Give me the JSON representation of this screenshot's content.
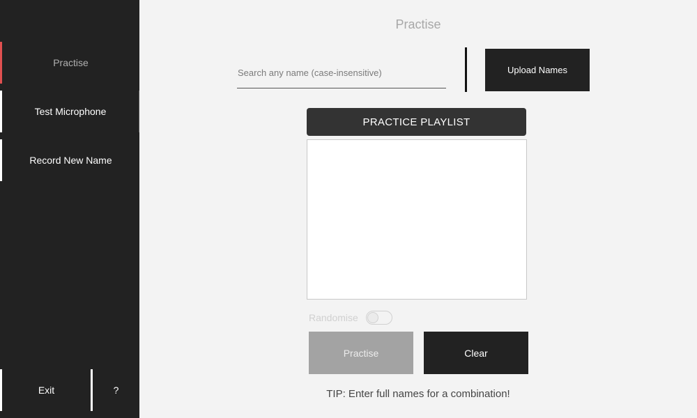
{
  "sidebar": {
    "items": [
      {
        "label": "Practise",
        "active": true
      },
      {
        "label": "Test Microphone",
        "active": false
      },
      {
        "label": "Record New Name",
        "active": false
      }
    ],
    "exit_label": "Exit",
    "help_label": "?"
  },
  "main": {
    "title": "Practise",
    "search": {
      "placeholder": "Search any name (case-insensitive)",
      "value": ""
    },
    "upload_label": "Upload Names",
    "playlist": {
      "header": "PRACTICE PLAYLIST",
      "items": []
    },
    "randomise": {
      "label": "Randomise",
      "enabled": false
    },
    "practise_label": "Practise",
    "clear_label": "Clear",
    "tip": "TIP: Enter full names for a combination!"
  },
  "colors": {
    "sidebar_bg": "#222222",
    "page_bg": "#f3f3f3",
    "active_accent": "#e05050",
    "button_dark": "#222222",
    "button_disabled": "#a3a3a3"
  }
}
